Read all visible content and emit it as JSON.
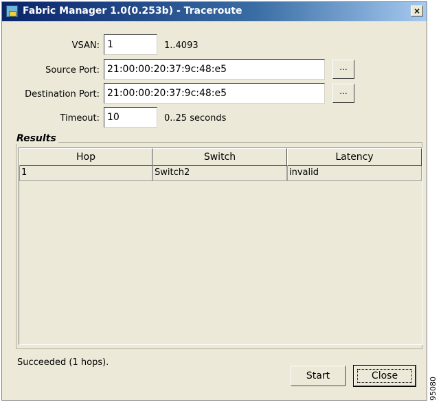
{
  "window": {
    "title": "Fabric Manager 1.0(0.253b) - Traceroute",
    "close_glyph": "×"
  },
  "form": {
    "vsan": {
      "label": "VSAN:",
      "value": "1",
      "hint": "1..4093"
    },
    "source_port": {
      "label": "Source Port:",
      "value": "21:00:00:20:37:9c:48:e5",
      "browse": "..."
    },
    "destination_port": {
      "label": "Destination Port:",
      "value": "21:00:00:20:37:9c:48:e5",
      "browse": "..."
    },
    "timeout": {
      "label": "Timeout:",
      "value": "10",
      "hint": "0..25 seconds"
    }
  },
  "results": {
    "title": "Results",
    "columns": [
      "Hop",
      "Switch",
      "Latency"
    ],
    "rows": [
      [
        "1",
        "Switch2",
        "invalid"
      ]
    ]
  },
  "status": "Succeeded (1 hops).",
  "buttons": {
    "start": "Start",
    "close": "Close"
  },
  "figure_number": "95080"
}
